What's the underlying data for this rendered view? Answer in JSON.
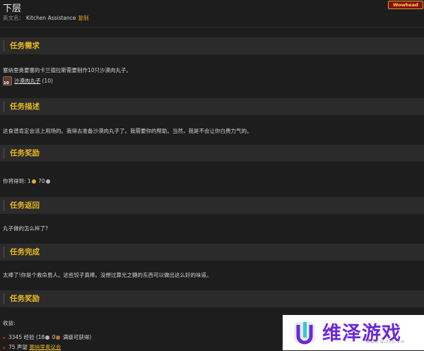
{
  "page": {
    "title": "下层",
    "badge": "Wowhead",
    "english_label": "英文名：",
    "english_name": "Kitchen Assistance",
    "copy_label": "复制"
  },
  "sections": {
    "requirements": {
      "header": "任务需求",
      "text": "塞纳里奥要塞的卡兰德拉斯需要制作10只沙漠肉丸子。",
      "item_count": "10",
      "item_name": "沙漠肉丸子",
      "item_qty": "(10)"
    },
    "description": {
      "header": "任务描述",
      "text": "这食谱肯定会派上用场的。我得去准备沙漠肉丸子了。我需要你的帮助。当然，我是不会让你白费力气的。"
    },
    "rewards": {
      "header": "任务奖励",
      "prefix": "你将得到: ",
      "gold": "1",
      "silver": "70"
    },
    "progress": {
      "header": "任务返回",
      "text": "丸子做的怎么样了?"
    },
    "completion": {
      "header": "任务完成",
      "text": "太棒了!你是个救命恩人。这些饺子真棒。没想过算光之糖的东西可以做出这么好的味道。"
    },
    "gains": {
      "header": "任务奖励",
      "label": "收益:",
      "xp_text": "3345 经验 (18",
      "xp_mid": " 0",
      "xp_suffix": " 满级可获得)",
      "rep_amount": "75 声望",
      "rep_faction": "塞纳里奥议会"
    }
  },
  "watermark": {
    "text": "维泽游戏",
    "sub": "WWW.WIZED.VIP"
  },
  "colors": {
    "accent": "#e8b820",
    "background": "#1d1d1d",
    "header_bg": "#2b2b2b",
    "watermark_purple": "#6a2ad8"
  }
}
